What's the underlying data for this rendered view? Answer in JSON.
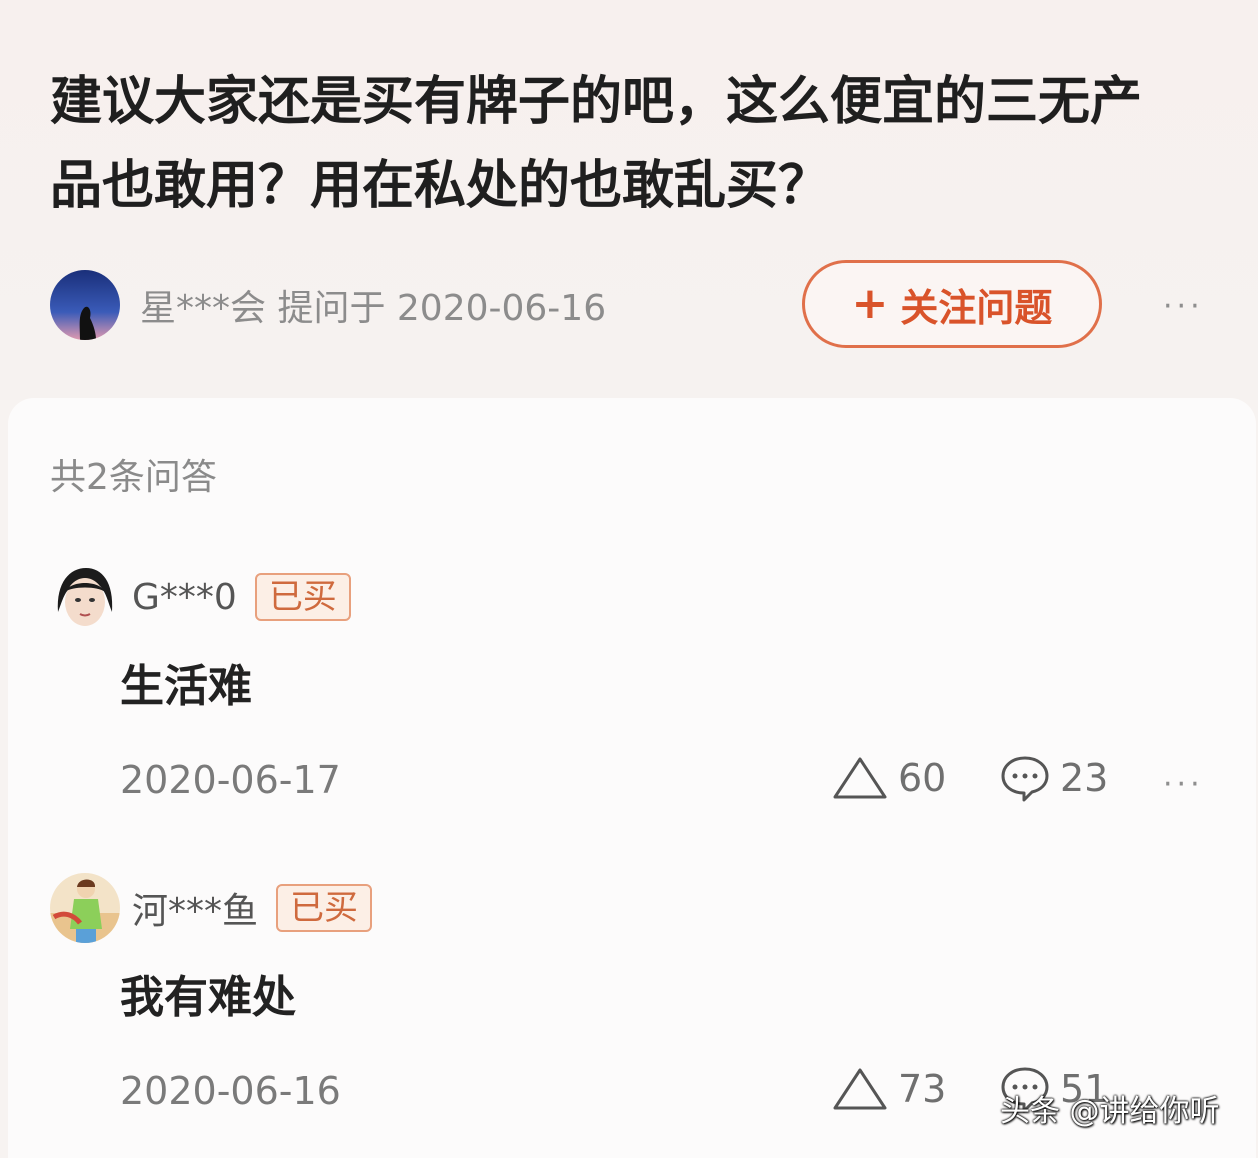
{
  "question": {
    "title": "建议大家还是买有牌子的吧，这么便宜的三无产品也敢用？用在私处的也敢乱买？",
    "asker_line": "星***会 提问于 2020-06-16",
    "follow_label": "关注问题",
    "follow_icon": "plus-icon",
    "more_icon": "···"
  },
  "answers_count": "共2条问答",
  "answers": [
    {
      "user": "G***0",
      "badge": "已买",
      "text": "生活难",
      "date": "2020-06-17",
      "likes": "60",
      "comments": "23",
      "more": "···"
    },
    {
      "user": "河***鱼",
      "badge": "已买",
      "text": "我有难处",
      "date": "2020-06-16",
      "likes": "73",
      "comments": "51"
    }
  ],
  "watermark": "头条 @讲给你听",
  "colors": {
    "accent": "#d9532a",
    "badge_border": "#e8a07d",
    "text": "#1f1f1f"
  }
}
